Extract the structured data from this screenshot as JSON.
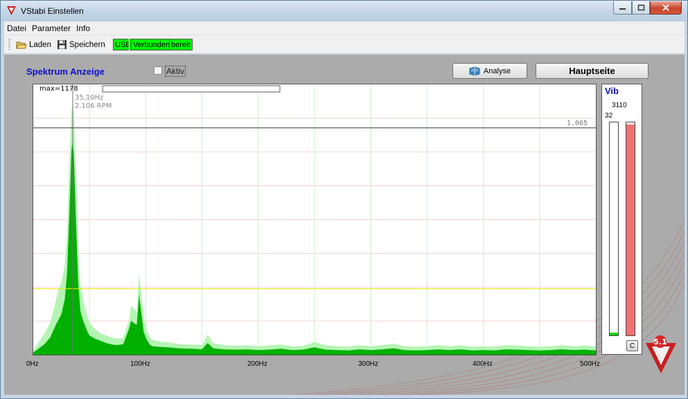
{
  "window": {
    "title": "VStabi Einstellen",
    "close_glyph": "✕",
    "minimize_glyph": "▭",
    "maximize_glyph": "□"
  },
  "menu": [
    "Datei",
    "Parameter",
    "Info"
  ],
  "toolbar": {
    "load_label": "Laden",
    "save_label": "Speichern",
    "status": [
      "USB",
      "Verbunden",
      "bereit"
    ],
    "status_color": "#00ff00"
  },
  "panel": {
    "title": "Spektrum Anzeige",
    "aktiv_label": "Aktiv",
    "aktiv_checked": false,
    "analyse_label": "Analyse",
    "home_label": "Hauptseite"
  },
  "chart_data": {
    "type": "area",
    "title": "",
    "xlabel": "",
    "ylabel": "",
    "xlim": [
      0,
      500
    ],
    "ylim": [
      0,
      1178
    ],
    "x_ticks": [
      "0Hz",
      "100Hz",
      "200Hz",
      "300Hz",
      "400Hz",
      "500Hz"
    ],
    "max_label": "max=1178",
    "cursor_freq": "35,10Hz",
    "cursor_rpm": "2.106 RPM",
    "cursor_x": 35.1,
    "reference_value_label": "1.065",
    "reference_value": 1065,
    "threshold_value": 310,
    "colors": {
      "current": "#00b000",
      "peak": "#b4f5b4",
      "threshold": "#e8e800",
      "cursor": "#707070"
    },
    "series": [
      {
        "name": "current",
        "x": [
          0,
          5,
          10,
          15,
          20,
          22,
          25,
          28,
          30,
          32,
          34,
          35,
          36,
          38,
          40,
          42,
          45,
          48,
          50,
          55,
          60,
          65,
          70,
          75,
          80,
          85,
          87,
          89,
          92,
          94,
          96,
          98,
          100,
          102,
          104,
          106,
          110,
          115,
          120,
          130,
          140,
          150,
          155,
          160,
          170,
          180,
          190,
          200,
          210,
          220,
          230,
          240,
          250,
          260,
          270,
          280,
          290,
          300,
          310,
          320,
          330,
          340,
          350,
          360,
          370,
          380,
          390,
          400,
          410,
          420,
          430,
          440,
          450,
          460,
          470,
          480,
          490,
          500
        ],
        "y": [
          10,
          30,
          50,
          80,
          140,
          160,
          190,
          260,
          380,
          650,
          960,
          1000,
          940,
          620,
          330,
          200,
          150,
          110,
          90,
          75,
          65,
          55,
          48,
          45,
          50,
          120,
          160,
          150,
          140,
          280,
          200,
          110,
          80,
          60,
          45,
          40,
          38,
          36,
          35,
          30,
          28,
          26,
          55,
          30,
          25,
          24,
          25,
          22,
          24,
          28,
          22,
          24,
          35,
          24,
          22,
          20,
          25,
          22,
          25,
          30,
          22,
          20,
          22,
          25,
          22,
          25,
          20,
          22,
          20,
          25,
          24,
          22,
          20,
          22,
          25,
          22,
          24,
          20
        ]
      },
      {
        "name": "peak",
        "x": [
          0,
          5,
          10,
          15,
          20,
          22,
          25,
          28,
          30,
          32,
          34,
          35,
          36,
          38,
          40,
          42,
          45,
          48,
          50,
          55,
          60,
          65,
          70,
          75,
          80,
          85,
          87,
          89,
          92,
          94,
          96,
          98,
          100,
          102,
          104,
          106,
          110,
          115,
          120,
          130,
          140,
          150,
          155,
          160,
          170,
          180,
          190,
          200,
          210,
          220,
          230,
          240,
          250,
          260,
          270,
          280,
          290,
          300,
          310,
          320,
          330,
          340,
          350,
          360,
          370,
          380,
          390,
          400,
          410,
          420,
          430,
          440,
          450,
          460,
          470,
          480,
          490,
          500
        ],
        "y": [
          20,
          60,
          100,
          150,
          250,
          300,
          340,
          420,
          560,
          900,
          1150,
          1178,
          1120,
          860,
          480,
          320,
          240,
          180,
          150,
          120,
          100,
          90,
          80,
          75,
          80,
          160,
          230,
          220,
          200,
          380,
          290,
          180,
          130,
          100,
          80,
          70,
          65,
          60,
          58,
          50,
          48,
          45,
          95,
          55,
          45,
          42,
          45,
          40,
          44,
          48,
          40,
          42,
          60,
          44,
          40,
          38,
          45,
          40,
          45,
          52,
          40,
          38,
          40,
          45,
          40,
          45,
          38,
          40,
          38,
          45,
          44,
          40,
          38,
          40,
          45,
          40,
          44,
          38
        ]
      }
    ]
  },
  "vib": {
    "title": "Vib",
    "value": "3110",
    "small_value": "32",
    "bar1_level": 0.012,
    "bar2_level": 0.99,
    "clear_label": "C"
  }
}
